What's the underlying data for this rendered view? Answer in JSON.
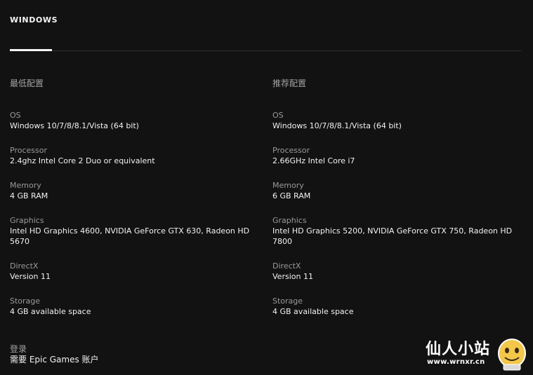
{
  "tabs": {
    "active_label": "WINDOWS"
  },
  "minimum": {
    "heading": "最低配置",
    "specs": [
      {
        "label": "OS",
        "value": "Windows 10/7/8/8.1/Vista (64 bit)"
      },
      {
        "label": "Processor",
        "value": "2.4ghz Intel Core 2 Duo or equivalent"
      },
      {
        "label": "Memory",
        "value": "4 GB RAM"
      },
      {
        "label": "Graphics",
        "value": "Intel HD Graphics 4600, NVIDIA GeForce GTX 630, Radeon HD 5670"
      },
      {
        "label": "DirectX",
        "value": "Version 11"
      },
      {
        "label": "Storage",
        "value": "4 GB available space"
      }
    ]
  },
  "recommended": {
    "heading": "推荐配置",
    "specs": [
      {
        "label": "OS",
        "value": "Windows 10/7/8/8.1/Vista (64 bit)"
      },
      {
        "label": "Processor",
        "value": "2.66GHz Intel Core i7"
      },
      {
        "label": "Memory",
        "value": "6 GB RAM"
      },
      {
        "label": "Graphics",
        "value": "Intel HD Graphics 5200, NVIDIA GeForce GTX 750, Radeon HD 7800"
      },
      {
        "label": "DirectX",
        "value": "Version 11"
      },
      {
        "label": "Storage",
        "value": "4 GB available space"
      }
    ]
  },
  "login": {
    "label": "登录",
    "value": "需要 Epic Games 账户"
  },
  "watermark": {
    "title": "仙人小站",
    "url": "www.wrnxr.cn",
    "icon": "mascot-face-icon"
  }
}
